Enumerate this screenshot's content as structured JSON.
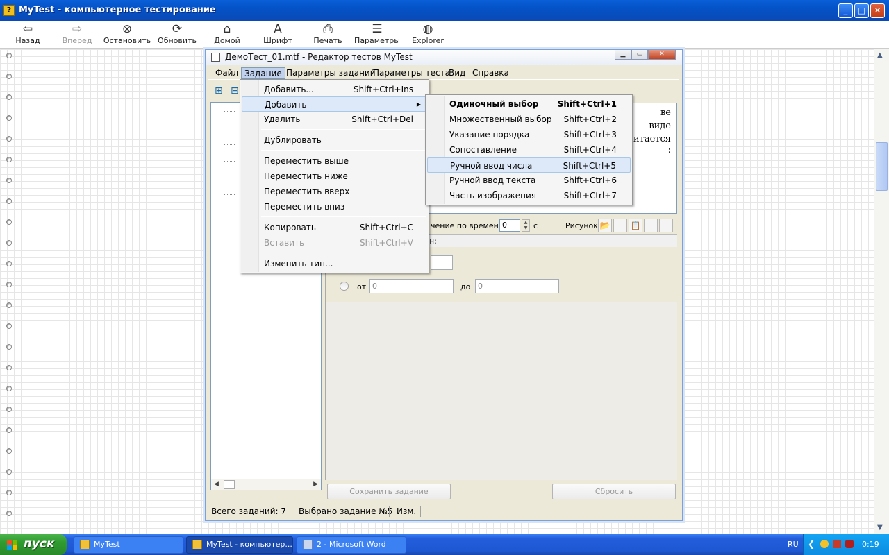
{
  "app": {
    "title": "MyTest - компьютерное тестирование",
    "icon_letter": "?"
  },
  "toolbar": [
    {
      "label": "Назад",
      "icon": "back-arrow-icon",
      "glyph": "⇦",
      "enabled": true
    },
    {
      "label": "Вперед",
      "icon": "forward-arrow-icon",
      "glyph": "⇨",
      "enabled": false
    },
    {
      "label": "Остановить",
      "icon": "stop-icon",
      "glyph": "⊗",
      "enabled": true
    },
    {
      "label": "Обновить",
      "icon": "refresh-icon",
      "glyph": "⟳",
      "enabled": true
    },
    {
      "label": "Домой",
      "icon": "home-icon",
      "glyph": "⌂",
      "enabled": true
    },
    {
      "label": "Шрифт",
      "icon": "font-icon",
      "glyph": "A",
      "enabled": true
    },
    {
      "label": "Печать",
      "icon": "printer-icon",
      "glyph": "⎙",
      "enabled": true
    },
    {
      "label": "Параметры",
      "icon": "settings-icon",
      "glyph": "☰",
      "enabled": true
    },
    {
      "label": "Explorer",
      "icon": "explorer-icon",
      "glyph": "◍",
      "enabled": true
    }
  ],
  "editor": {
    "title": "ДемоТест_01.mtf - Редактор тестов MyTest",
    "menu": [
      "Файл",
      "Задание",
      "Параметры заданий",
      "Параметры теста",
      "Вид",
      "Справка"
    ],
    "active_menu": "Задание",
    "question_text_fragments": [
      "ве",
      "виде",
      "итается",
      ":"
    ],
    "time_label": "чение по времени:",
    "time_value": "0",
    "time_unit": "с",
    "picture_label": "Рисунок:",
    "answer_header": "н:",
    "from_label": "от",
    "to_label": "до",
    "from_value": "0",
    "to_value": "0",
    "save_button": "Сохранить задание",
    "reset_button": "Сбросить",
    "status": {
      "total": "Всего заданий: 7",
      "selected": "Выбрано задание №5",
      "modified": "Изм."
    }
  },
  "task_menu": {
    "items": [
      {
        "label": "Добавить...",
        "shortcut": "Shift+Ctrl+Ins",
        "disabled": false
      },
      {
        "label": "Добавить",
        "shortcut": "",
        "submenu": true,
        "highlighted": true
      },
      {
        "label": "Удалить",
        "shortcut": "Shift+Ctrl+Del",
        "disabled": false
      },
      {
        "label": "Дублировать",
        "shortcut": "",
        "disabled": false
      },
      {
        "label": "Переместить выше",
        "shortcut": "",
        "disabled": false
      },
      {
        "label": "Переместить ниже",
        "shortcut": "",
        "disabled": false
      },
      {
        "label": "Переместить вверх",
        "shortcut": "",
        "disabled": false
      },
      {
        "label": "Переместить вниз",
        "shortcut": "",
        "disabled": false
      },
      {
        "label": "Копировать",
        "shortcut": "Shift+Ctrl+C",
        "disabled": false
      },
      {
        "label": "Вставить",
        "shortcut": "Shift+Ctrl+V",
        "disabled": true
      },
      {
        "label": "Изменить тип...",
        "shortcut": "",
        "disabled": false
      }
    ]
  },
  "add_submenu": {
    "items": [
      {
        "label": "Одиночный выбор",
        "shortcut": "Shift+Ctrl+1",
        "bold": true
      },
      {
        "label": "Множественный выбор",
        "shortcut": "Shift+Ctrl+2"
      },
      {
        "label": "Указание порядка",
        "shortcut": "Shift+Ctrl+3"
      },
      {
        "label": "Сопоставление",
        "shortcut": "Shift+Ctrl+4"
      },
      {
        "label": "Ручной ввод числа",
        "shortcut": "Shift+Ctrl+5",
        "highlighted": true
      },
      {
        "label": "Ручной ввод текста",
        "shortcut": "Shift+Ctrl+6"
      },
      {
        "label": "Часть изображения",
        "shortcut": "Shift+Ctrl+7"
      }
    ]
  },
  "taskbar": {
    "start_label": "пуск",
    "tasks": [
      "MyTest",
      "MyTest - компьютер...",
      "2 - Microsoft Word"
    ],
    "lang": "RU",
    "clock": "0:19"
  },
  "colors": {
    "title_blue": "#0453c7",
    "menu_highlight": "#dde9f8",
    "taskbar": "#245edb",
    "start_green": "#2f9b2f"
  }
}
